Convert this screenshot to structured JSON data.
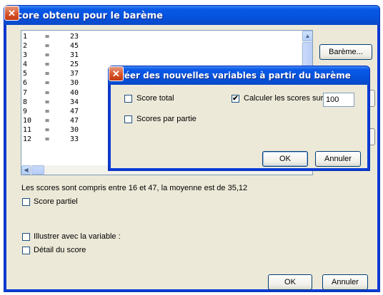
{
  "window": {
    "title": "Score obtenu pour le barème",
    "close_glyph": "✕"
  },
  "score_list": {
    "rows": [
      {
        "n": "1",
        "eq": "=",
        "v": "23"
      },
      {
        "n": "2",
        "eq": "=",
        "v": "45"
      },
      {
        "n": "3",
        "eq": "=",
        "v": "31"
      },
      {
        "n": "4",
        "eq": "=",
        "v": "25"
      },
      {
        "n": "5",
        "eq": "=",
        "v": "37"
      },
      {
        "n": "6",
        "eq": "=",
        "v": "30"
      },
      {
        "n": "7",
        "eq": "=",
        "v": "40"
      },
      {
        "n": "8",
        "eq": "=",
        "v": "34"
      },
      {
        "n": "9",
        "eq": "=",
        "v": "47"
      },
      {
        "n": "10",
        "eq": "=",
        "v": "47"
      },
      {
        "n": "11",
        "eq": "=",
        "v": "30"
      },
      {
        "n": "12",
        "eq": "=",
        "v": "33"
      }
    ]
  },
  "buttons": {
    "bareme": "Barème...",
    "ok": "OK",
    "cancel": "Annuler"
  },
  "summary_text": "Les scores sont compris entre 16 et 47, la moyenne est de 35,12",
  "checkboxes": {
    "score_partiel": {
      "label": "Score partiel",
      "checked": false
    },
    "illustrer": {
      "label": "Illustrer avec la variable :",
      "checked": false
    },
    "detail": {
      "label": "Détail du score",
      "checked": false
    }
  },
  "dialog": {
    "title": "Créer des nouvelles variables à partir du barème",
    "score_total": {
      "label": "Score total",
      "checked": false
    },
    "scores_par_partie": {
      "label": "Scores par partie",
      "checked": false
    },
    "calculer": {
      "label": "Calculer les scores sur",
      "checked": true,
      "value": "100"
    },
    "ok": "OK",
    "cancel": "Annuler"
  },
  "icons": {
    "close": "close-icon",
    "scroll_up": "scroll-up-icon",
    "scroll_left": "scroll-left-icon",
    "check": "checkmark-icon"
  }
}
